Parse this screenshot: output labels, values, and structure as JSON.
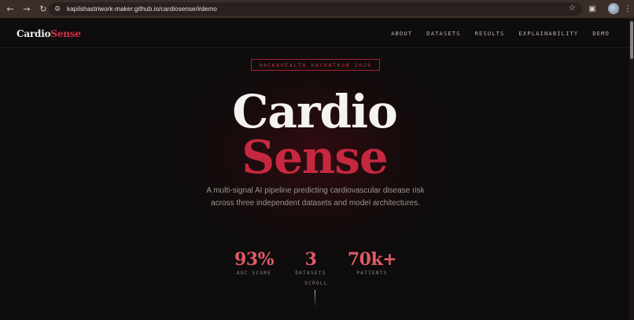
{
  "browser": {
    "url": "kapilshastriwork-maker.github.io/cardiosense/#demo",
    "icons": {
      "back": "back-arrow-icon",
      "forward": "forward-arrow-icon",
      "reload": "reload-icon",
      "site_info": "site-info-icon",
      "bookmark": "star-icon",
      "extensions": "puzzle-icon",
      "menu": "kebab-menu-icon"
    }
  },
  "nav": {
    "brand_part1": "Cardio",
    "brand_part2": "Sense",
    "links": [
      "ABOUT",
      "DATASETS",
      "RESULTS",
      "EXPLAINABILITY",
      "DEMO"
    ]
  },
  "hero": {
    "badge": "HACKAHEALTH HACKATHON 2026",
    "title_line1": "Cardio",
    "title_line2": "Sense",
    "description": "A multi-signal AI pipeline predicting cardiovascular disease risk across three independent datasets and model architectures."
  },
  "stats": [
    {
      "value": "93%",
      "label": "AUC SCORE"
    },
    {
      "value": "3",
      "label": "DATASETS"
    },
    {
      "value": "70k+",
      "label": "PATIENTS"
    }
  ],
  "scroll_label": "SCROLL",
  "colors": {
    "accent": "#c5283f",
    "stat": "#e05a66",
    "background": "#0e0c0c",
    "chrome": "#3a2e29"
  }
}
